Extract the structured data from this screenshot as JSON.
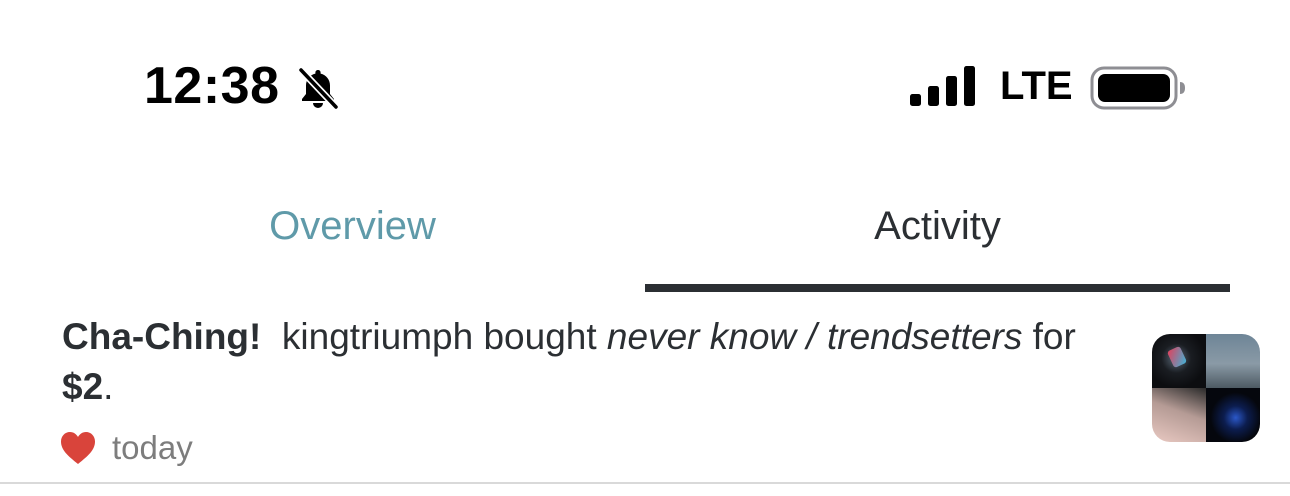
{
  "status_bar": {
    "time": "12:38",
    "network": "LTE",
    "icons": [
      "bell-slash-icon",
      "signal-bars-icon",
      "battery-icon"
    ]
  },
  "tabs": [
    {
      "label": "Overview",
      "active": false,
      "color": "#5f9aa9"
    },
    {
      "label": "Activity",
      "active": true,
      "color": "#2b2f33"
    }
  ],
  "activity": {
    "headline": "Cha-Ching!",
    "actor": "kingtriumph",
    "verb": "bought",
    "item": "never know / trendsetters",
    "preposition": "for",
    "price": "$2",
    "period": ".",
    "time_ago": "today",
    "icon": "heart-icon",
    "heart_color": "#d9443b"
  }
}
